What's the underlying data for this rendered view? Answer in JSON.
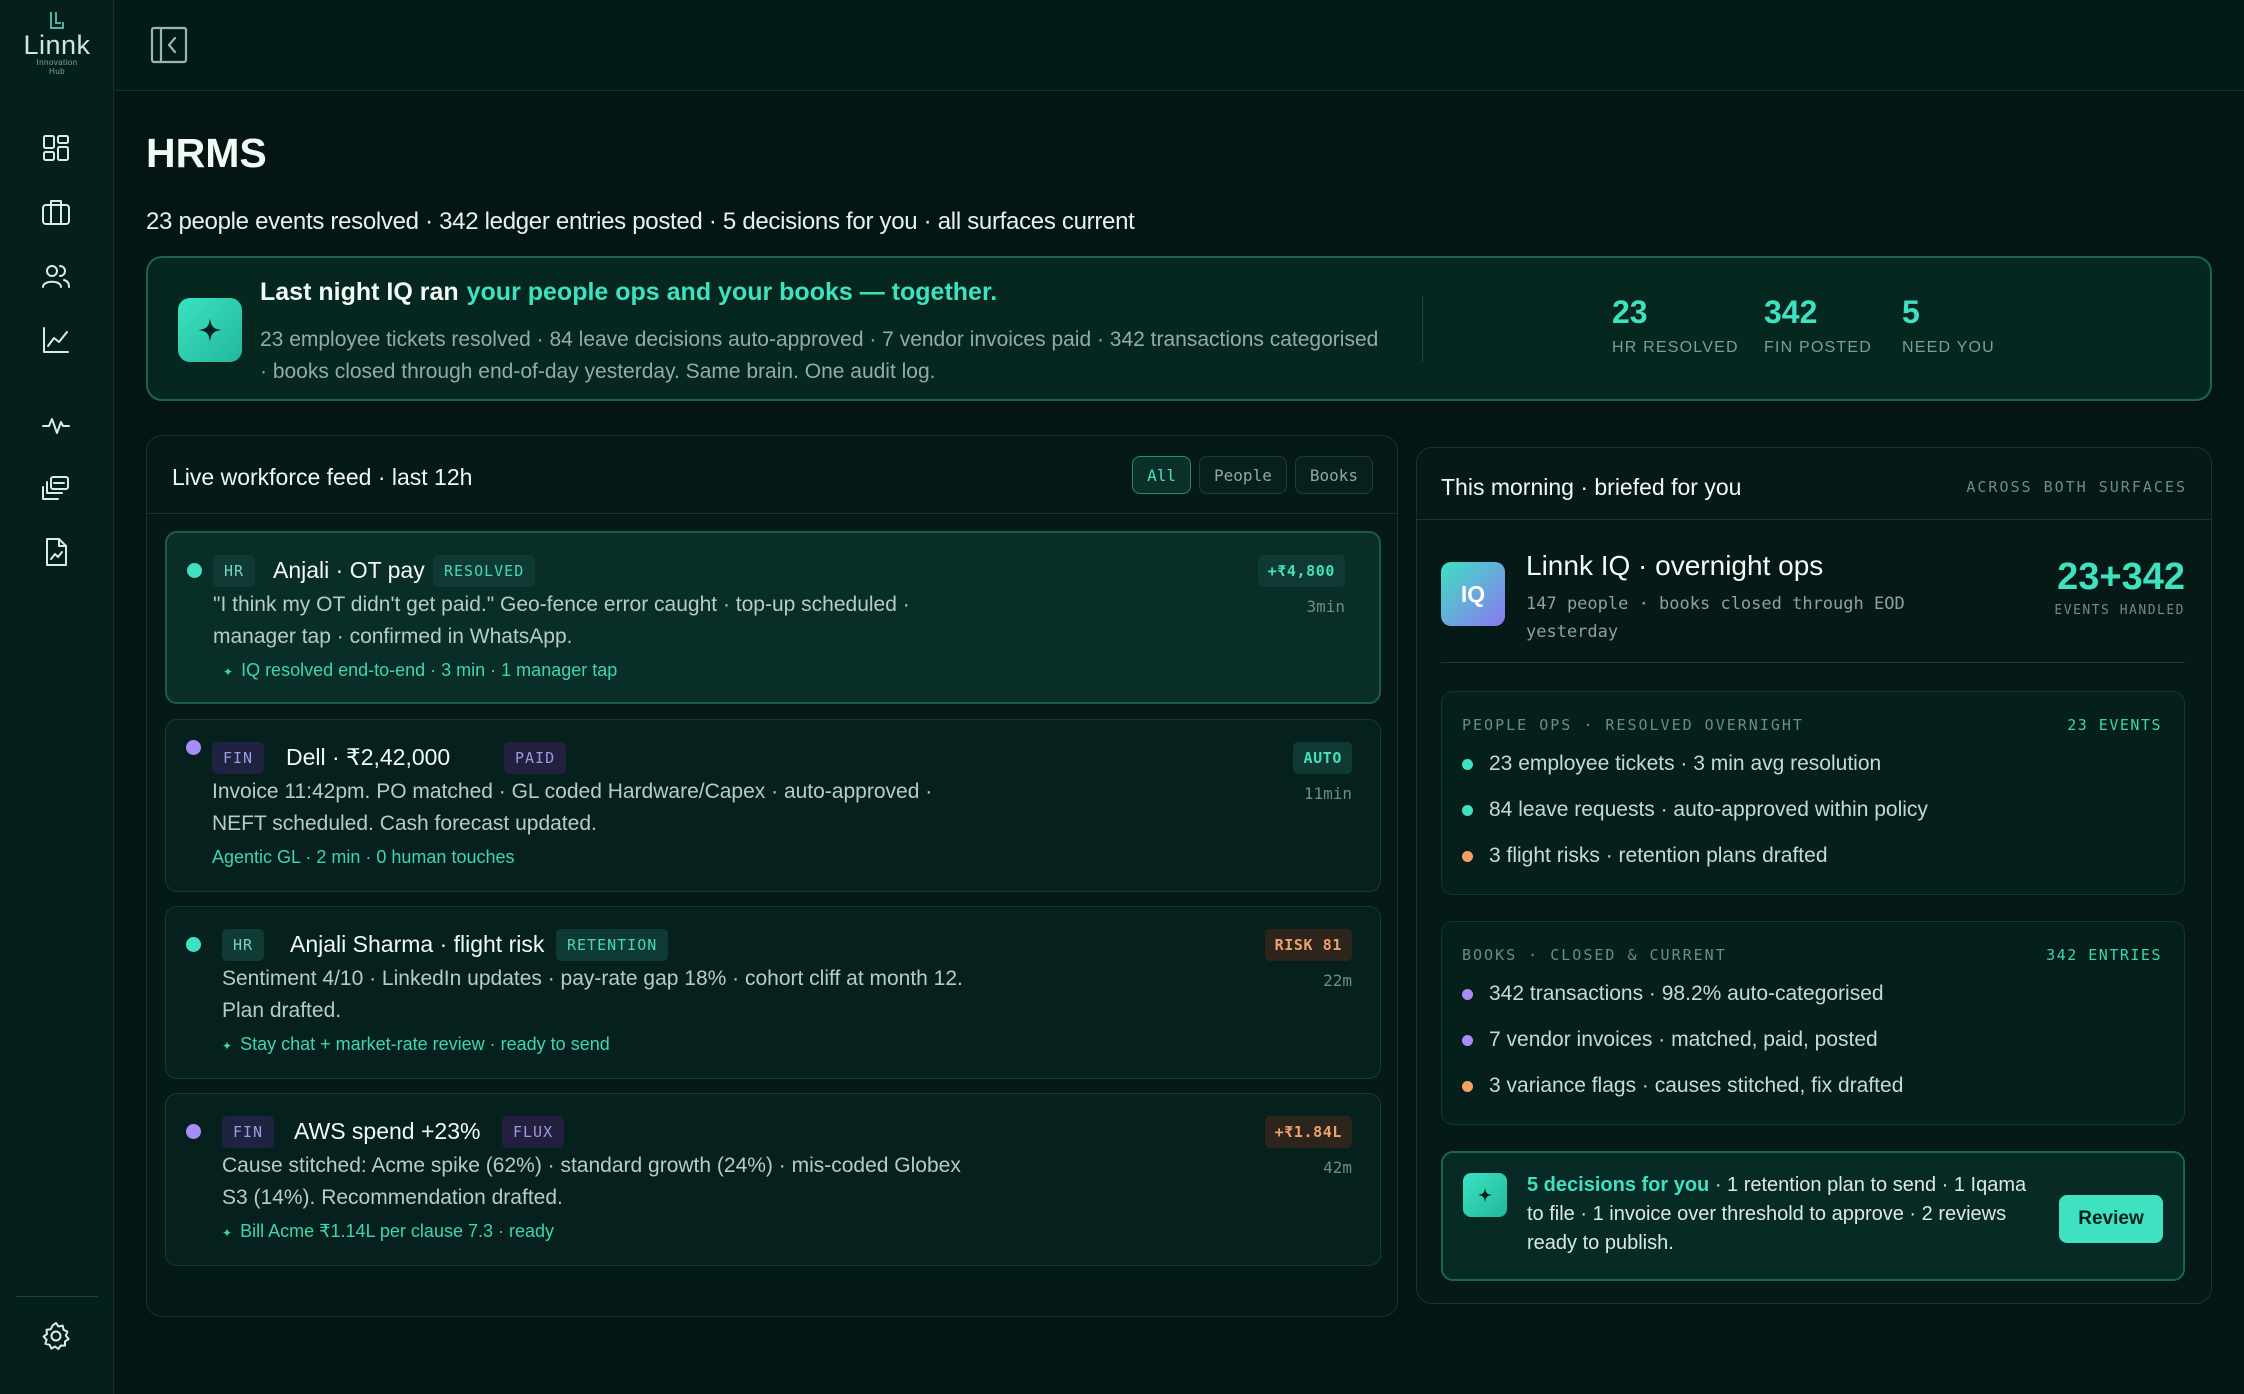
{
  "app": {
    "logo_text": "Linnk",
    "logo_sub1": "Innovation",
    "logo_sub2": "Hub"
  },
  "sidebar": {
    "items": [
      {
        "name": "dashboard-icon"
      },
      {
        "name": "briefcase-icon"
      },
      {
        "name": "people-icon"
      },
      {
        "name": "chart-icon"
      },
      {
        "name": "activity-icon"
      },
      {
        "name": "layers-icon"
      },
      {
        "name": "report-icon"
      }
    ],
    "settings": "gear-icon"
  },
  "page": {
    "title": "HRMS",
    "summary": "23 people events resolved · 342 ledger entries posted · 5 decisions for you · all surfaces current"
  },
  "banner": {
    "lead": "Last night IQ ran",
    "accent": "your people ops and your books — together.",
    "desc": "23 employee tickets resolved · 84 leave decisions auto-approved · 7 vendor invoices paid · 342 transactions categorised · books closed through end-of-day yesterday. Same brain. One audit log.",
    "stats": [
      {
        "value": "23",
        "label": "HR RESOLVED"
      },
      {
        "value": "342",
        "label": "FIN POSTED"
      },
      {
        "value": "5",
        "label": "NEED YOU"
      }
    ]
  },
  "feed": {
    "title": "Live workforce feed · last 12h",
    "filters": [
      "All",
      "People",
      "Books"
    ],
    "active_filter": "All",
    "cards": [
      {
        "tag": "HR",
        "title": "Anjali · OT pay",
        "status": "RESOLVED",
        "body": "\"I think my OT didn't get paid.\" Geo-fence error caught · top-up scheduled · manager tap · confirmed in WhatsApp.",
        "foot": "IQ resolved end-to-end · 3 min · 1 manager tap",
        "badge": "+₹4,800",
        "time": "3min"
      },
      {
        "tag": "FIN",
        "title": "Dell · ₹2,42,000",
        "status": "PAID",
        "body": "Invoice 11:42pm. PO matched · GL coded Hardware/Capex · auto-approved · NEFT scheduled. Cash forecast updated.",
        "foot": "Agentic GL · 2 min · 0 human touches",
        "badge": "AUTO",
        "time": "11min"
      },
      {
        "tag": "HR",
        "title": "Anjali Sharma · flight risk",
        "status": "RETENTION",
        "body": "Sentiment 4/10 · LinkedIn updates · pay-rate gap 18% · cohort cliff at month 12. Plan drafted.",
        "foot": "Stay chat + market-rate review · ready to send",
        "badge": "RISK 81",
        "time": "22m"
      },
      {
        "tag": "FIN",
        "title": "AWS spend +23%",
        "status": "FLUX",
        "body": "Cause stitched: Acme spike (62%) · standard growth (24%) · mis-coded Globex S3 (14%). Recommendation drafted.",
        "foot": "Bill Acme ₹1.14L per clause 7.3 · ready",
        "badge": "+₹1.84L",
        "time": "42m"
      }
    ]
  },
  "brief": {
    "title": "This morning · briefed for you",
    "scope": "ACROSS BOTH SURFACES",
    "iq": {
      "badge": "IQ",
      "title": "Linnk IQ · overnight ops",
      "sub": "147 people · books closed through EOD yesterday",
      "stat": "23+342",
      "stat_label": "EVENTS HANDLED"
    },
    "people": {
      "head": "PEOPLE OPS · RESOLVED OVERNIGHT",
      "count": "23 EVENTS",
      "items": [
        "23 employee tickets · 3 min avg resolution",
        "84 leave requests · auto-approved within policy",
        "3 flight risks · retention plans drafted"
      ]
    },
    "books": {
      "head": "BOOKS · CLOSED & CURRENT",
      "count": "342 ENTRIES",
      "items": [
        "342 transactions · 98.2% auto-categorised",
        "7 vendor invoices · matched, paid, posted",
        "3 variance flags · causes stitched, fix drafted"
      ]
    },
    "decision": {
      "accent": "5 decisions for you",
      "text": " · 1 retention plan to send · 1 Iqama to file · 1 invoice over threshold to approve · 2 reviews ready to publish.",
      "button": "Review"
    }
  },
  "colors": {
    "accent": "#3fe2c0",
    "background": "#041614",
    "purple": "#a98cf5",
    "orange": "#f5a063"
  }
}
